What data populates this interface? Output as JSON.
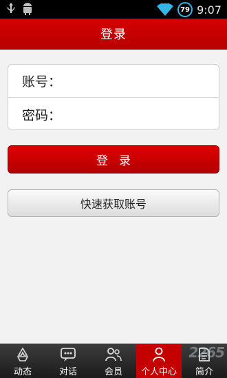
{
  "status_bar": {
    "battery": "79",
    "time": "9:07",
    "icons": [
      "usb-icon",
      "android-debug-icon",
      "wifi-icon",
      "battery-icon"
    ]
  },
  "header": {
    "title": "登录"
  },
  "form": {
    "account_label": "账号：",
    "account_value": "",
    "password_label": "密码：",
    "password_value": ""
  },
  "buttons": {
    "login": "登录",
    "quick_account": "快速获取账号"
  },
  "bottom_nav": {
    "items": [
      {
        "label": "动态",
        "icon": "recycle-icon"
      },
      {
        "label": "对话",
        "icon": "chat-bubble-icon"
      },
      {
        "label": "会员",
        "icon": "members-icon"
      },
      {
        "label": "个人中心",
        "icon": "person-icon",
        "active": true
      },
      {
        "label": "简介",
        "icon": "document-icon"
      }
    ]
  },
  "watermark": "2265"
}
